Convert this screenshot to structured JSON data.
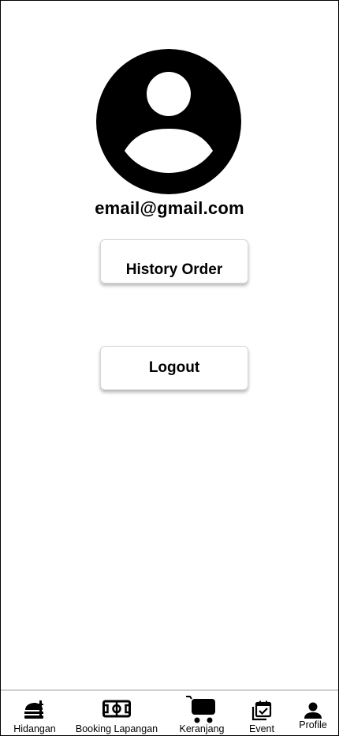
{
  "profile": {
    "avatar_icon": "user-avatar-icon",
    "email": "email@gmail.com"
  },
  "actions": {
    "history_label": "History Order",
    "logout_label": "Logout"
  },
  "bottom_nav": {
    "items": [
      {
        "label": "Hidangan",
        "icon": "food-icon"
      },
      {
        "label": "Booking Lapangan",
        "icon": "field-icon"
      },
      {
        "label": "Keranjang",
        "icon": "cart-icon"
      },
      {
        "label": "Event",
        "icon": "calendar-check-icon"
      },
      {
        "label": "Profile",
        "icon": "person-icon"
      }
    ],
    "active_index": 4
  }
}
